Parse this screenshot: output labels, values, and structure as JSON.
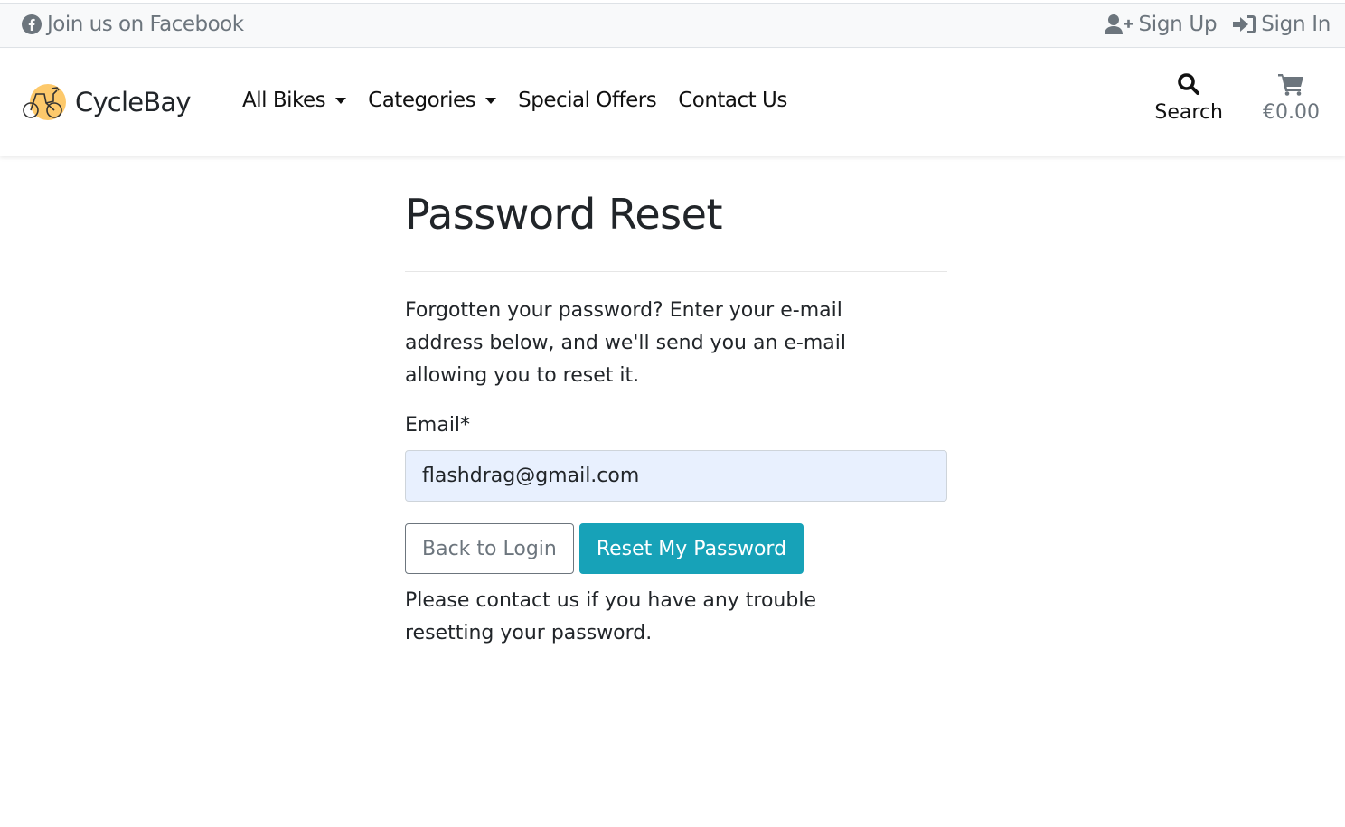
{
  "topbar": {
    "facebook_label": "Join us on Facebook",
    "signup_label": "Sign Up",
    "signin_label": "Sign In"
  },
  "navbar": {
    "brand": "CycleBay",
    "links": [
      {
        "label": "All Bikes",
        "dropdown": true
      },
      {
        "label": "Categories",
        "dropdown": true
      },
      {
        "label": "Special Offers",
        "dropdown": false
      },
      {
        "label": "Contact Us",
        "dropdown": false
      }
    ],
    "search_label": "Search",
    "cart_total": "€0.00"
  },
  "page": {
    "title": "Password Reset",
    "intro": "Forgotten your password? Enter your e-mail address below, and we'll send you an e-mail allowing you to reset it.",
    "email_label": "Email*",
    "email_value": "flashdrag@gmail.com",
    "back_button": "Back to Login",
    "reset_button": "Reset My Password",
    "note": "Please contact us if you have any trouble resetting your password."
  },
  "colors": {
    "accent": "#17a2b8",
    "muted": "#6c757d",
    "logo": "#fdc96b",
    "input_bg": "#e8f0fe"
  }
}
